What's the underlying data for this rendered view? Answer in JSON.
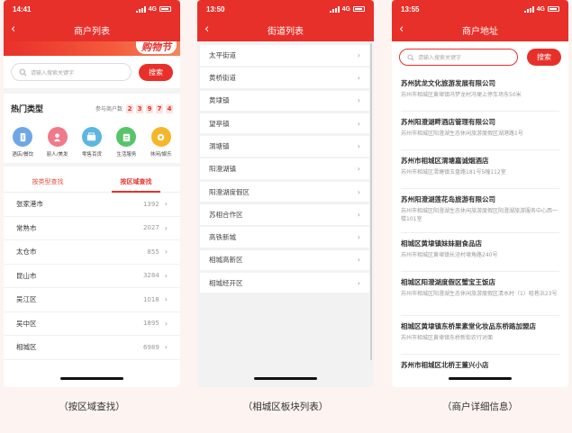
{
  "colors": {
    "accent": "#e8302a",
    "background": "#fdf3f1"
  },
  "screen1": {
    "status_time": "14:41",
    "network": "4G",
    "title": "商户列表",
    "banner_text": "购物节",
    "search_placeholder": "请输入搜索关键字",
    "search_button": "搜索",
    "hot_title": "热门类型",
    "merchant_count_label": "参与商户数",
    "merchant_count_digits": [
      "2",
      "3",
      "9",
      "7",
      "4"
    ],
    "categories": [
      {
        "label": "酒店/餐饮",
        "icon": "hotel-icon",
        "color": "#6fa7e6"
      },
      {
        "label": "丽人/美发",
        "icon": "beauty-icon",
        "color": "#f07a8a"
      },
      {
        "label": "零售百货",
        "icon": "retail-icon",
        "color": "#5bb7e0"
      },
      {
        "label": "生活服务",
        "icon": "life-service-icon",
        "color": "#58c46a"
      },
      {
        "label": "休闲/娱乐",
        "icon": "leisure-icon",
        "color": "#f5b62a"
      }
    ],
    "tabs": {
      "by_type": "按类型查找",
      "by_area": "按区域查找"
    },
    "cities": [
      {
        "name": "张家港市",
        "count": "1392"
      },
      {
        "name": "常熟市",
        "count": "2027"
      },
      {
        "name": "太仓市",
        "count": "855"
      },
      {
        "name": "昆山市",
        "count": "3284"
      },
      {
        "name": "吴江区",
        "count": "1018"
      },
      {
        "name": "吴中区",
        "count": "1895"
      },
      {
        "name": "相城区",
        "count": "6989"
      }
    ]
  },
  "screen2": {
    "status_time": "13:50",
    "network": "4G",
    "title": "街道列表",
    "streets": [
      "太平街道",
      "黄桥街道",
      "黄埭镇",
      "望亭镇",
      "渭塘镇",
      "阳澄湖镇",
      "阳澄湖度假区",
      "苏相合作区",
      "高铁新城",
      "相城高新区",
      "相城经开区"
    ]
  },
  "screen3": {
    "status_time": "13:55",
    "network": "4G",
    "title": "商户地址",
    "search_placeholder": "请输入搜索关键字",
    "search_button": "搜索",
    "merchants": [
      {
        "name": "苏州犹龙文化旅游发展有限公司",
        "address": "苏州市相城区黄埭镇冯梦龙村冯埂上停车场东50米"
      },
      {
        "name": "苏州阳澄湖畔酒店管理有限公司",
        "address": "苏州市相城区阳澄湖生态休闲旅游度假区湖港路1号"
      },
      {
        "name": "苏州市相城区渭塘嘉诚烟酒店",
        "address": "苏州市相城区渭塘镇玉盘路181号5幢112室"
      },
      {
        "name": "苏州阳澄湖莲花岛旅游有限公司",
        "address": "苏州市相城区阳澄湖生态休闲旅游度假区阳澄湖旅游服务中心西一楼101室"
      },
      {
        "name": "相城区黄埭镇妹妹副食品店",
        "address": "苏州市相城区黄埭镇长泾村埭角路240号"
      },
      {
        "name": "相城区阳澄湖度假区蟹宝王饭店",
        "address": "苏州市相城区阳澄湖生态休闲旅游度假区清水村（1）咀巷浜23号"
      },
      {
        "name": "相城区黄埭镇东桥果素堂化妆品东桥路加盟店",
        "address": "苏州市相城区黄埭镇东桥新街农行对面"
      },
      {
        "name": "苏州市相城区北桥王董兴小店",
        "address": ""
      }
    ]
  },
  "captions": [
    "（按区域查找）",
    "（相城区板块列表）",
    "（商户详细信息）"
  ]
}
